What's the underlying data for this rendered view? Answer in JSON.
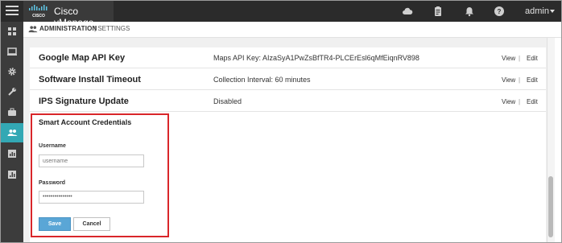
{
  "topbar": {
    "app_title": "Cisco vManage",
    "logo_text": "CISCO",
    "user_label": "admin"
  },
  "header": {
    "title": "ADMINISTRATION",
    "separator": "|",
    "subtitle": "SETTINGS"
  },
  "settings": [
    {
      "label": "Google Map API Key",
      "value": "Maps API Key: AIzaSyA1PwZsBfTR4-PLCErEsl6qMfEiqnRV898",
      "view": "View",
      "sep": "|",
      "edit": "Edit"
    },
    {
      "label": "Software Install Timeout",
      "value": "Collection Interval: 60 minutes",
      "view": "View",
      "sep": "|",
      "edit": "Edit"
    },
    {
      "label": "IPS Signature Update",
      "value": "Disabled",
      "view": "View",
      "sep": "|",
      "edit": "Edit"
    }
  ],
  "smart_account": {
    "title": "Smart Account Credentials",
    "username_label": "Username",
    "username_placeholder": "username",
    "password_label": "Password",
    "password_value": "•••••••••••••••",
    "save_label": "Save",
    "cancel_label": "Cancel"
  },
  "colors": {
    "topbar": "#2b2b2b",
    "sidebar": "#3c3c3c",
    "active_nav": "#33a8b4",
    "save_button": "#5aa6d6",
    "highlight": "#d9262a"
  },
  "icons": {
    "topbar": [
      "cloud-icon",
      "clipboard-icon",
      "bell-icon",
      "help-icon"
    ],
    "sidebar": [
      "dashboard-icon",
      "monitor-icon",
      "gear-icon",
      "wrench-icon",
      "briefcase-icon",
      "users-icon",
      "analytics-icon",
      "report-icon"
    ]
  }
}
